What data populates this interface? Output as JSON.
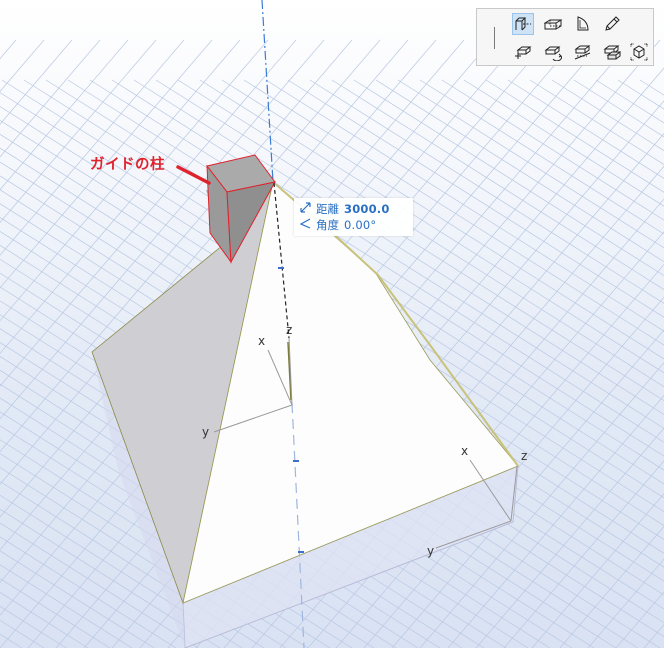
{
  "annotation": {
    "guide_column_label": "ガイドの柱"
  },
  "tracker": {
    "distance_label": "距離",
    "distance_value": "3000.0",
    "angle_label": "角度",
    "angle_value": "0.00°"
  },
  "axes": {
    "left_x": "x",
    "left_y": "y",
    "left_z": "z",
    "right_x": "x",
    "right_y": "y",
    "right_z": "z"
  },
  "palette": {
    "tools": [
      {
        "name": "guide-line-icon",
        "active": true
      },
      {
        "name": "guide-plane-icon",
        "active": false
      },
      {
        "name": "guide-curve-icon",
        "active": false
      },
      {
        "name": "pencil-icon",
        "active": false
      },
      {
        "name": "offset-plane-icon",
        "active": false
      },
      {
        "name": "rotate-plane-icon",
        "active": false
      },
      {
        "name": "plane-from-edge-icon",
        "active": false
      },
      {
        "name": "plane-from-face-icon",
        "active": false
      },
      {
        "name": "object-snap-icon",
        "active": false
      }
    ]
  },
  "colors": {
    "grid_line": "#b9c8e3",
    "guide_line": "#3a7bd5",
    "guide_column_outline": "#e0222c",
    "active_tool_bg": "#cfe3f7",
    "annotation_text": "#e0222c"
  }
}
